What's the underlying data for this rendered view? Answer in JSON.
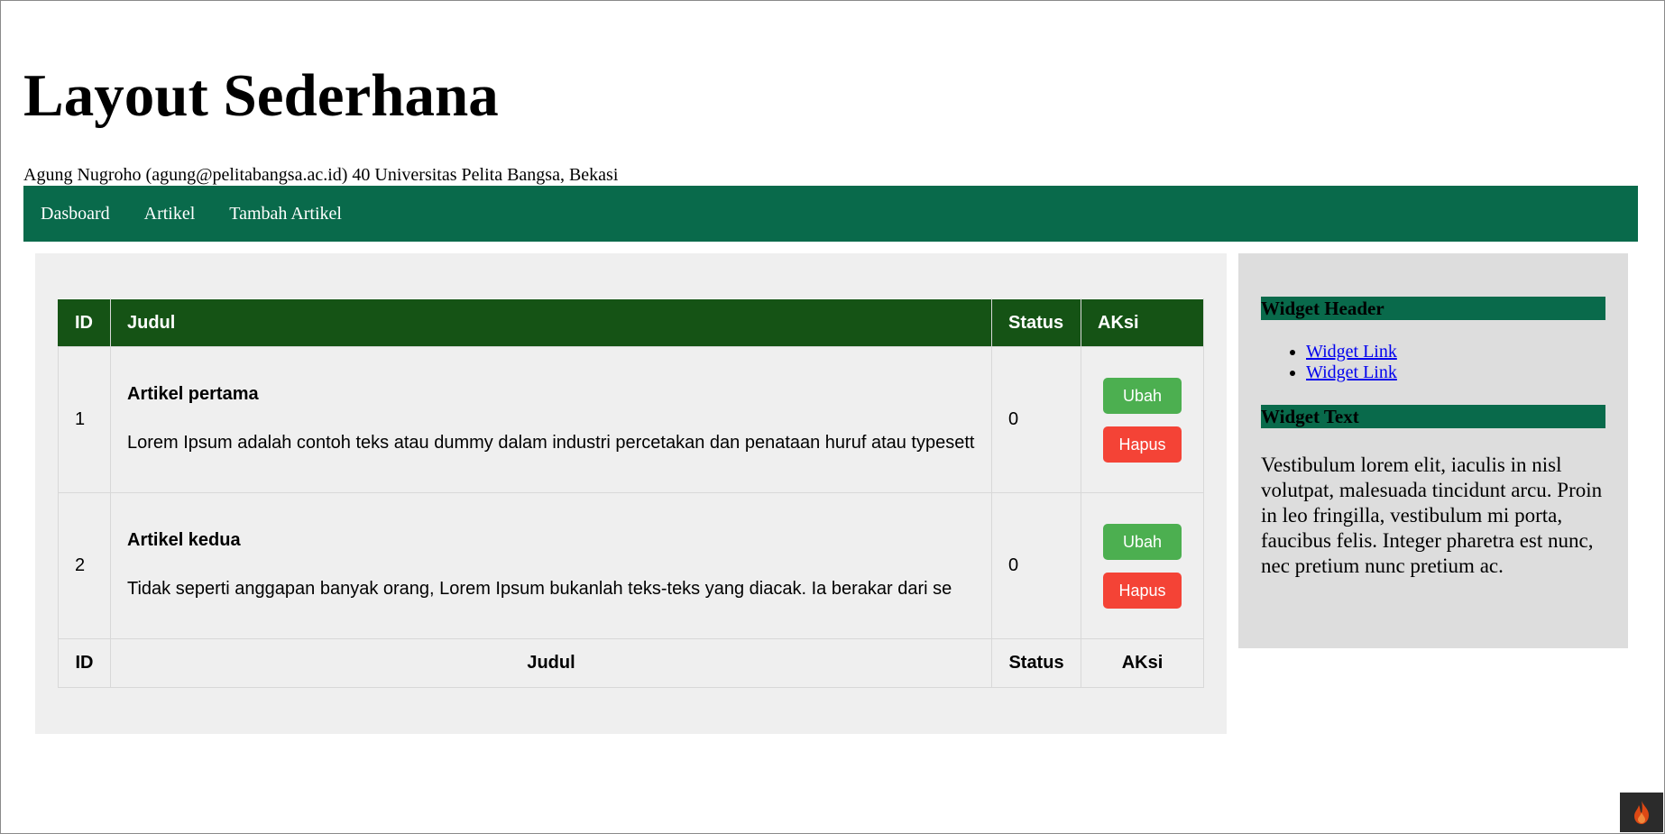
{
  "header": {
    "title": "Layout Sederhana",
    "author_line": "Agung Nugroho (agung@pelitabangsa.ac.id) 40 Universitas Pelita Bangsa, Bekasi"
  },
  "nav": {
    "items": [
      {
        "label": "Dasboard"
      },
      {
        "label": "Artikel"
      },
      {
        "label": "Tambah Artikel"
      }
    ],
    "bg_color": "#096a4b"
  },
  "table": {
    "columns": [
      "ID",
      "Judul",
      "Status",
      "AKsi"
    ],
    "rows": [
      {
        "id": "1",
        "title": "Artikel pertama",
        "body": "Lorem Ipsum adalah contoh teks atau dummy dalam industri percetakan dan penataan huruf atau typesett",
        "status": "0",
        "edit_label": "Ubah",
        "delete_label": "Hapus"
      },
      {
        "id": "2",
        "title": "Artikel kedua",
        "body": "Tidak seperti anggapan banyak orang, Lorem Ipsum bukanlah teks-teks yang diacak. Ia berakar dari se",
        "status": "0",
        "edit_label": "Ubah",
        "delete_label": "Hapus"
      }
    ],
    "header_color": "#155315",
    "edit_color": "#4caf50",
    "delete_color": "#f44336"
  },
  "sidebar": {
    "widget_header": "Widget Header",
    "links": [
      {
        "label": "Widget Link"
      },
      {
        "label": "Widget Link"
      }
    ],
    "widget_text_header": "Widget Text",
    "widget_text": "Vestibulum lorem elit, iaculis in nisl volutpat, malesuada tincidunt arcu. Proin in leo fringilla, vestibulum mi porta, faucibus felis. Integer pharetra est nunc, nec pretium nunc pretium ac."
  },
  "badge": {
    "icon": "flame-icon"
  }
}
